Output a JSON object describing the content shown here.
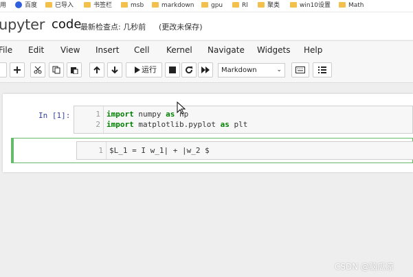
{
  "bookmarks": [
    {
      "label": "用",
      "icon": "none"
    },
    {
      "label": "百度",
      "icon": "baidu-icon"
    },
    {
      "label": "已导入",
      "icon": "folder-icon"
    },
    {
      "label": "书签栏",
      "icon": "folder-icon"
    },
    {
      "label": "msb",
      "icon": "folder-icon"
    },
    {
      "label": "markdown",
      "icon": "folder-icon"
    },
    {
      "label": "gpu",
      "icon": "folder-icon"
    },
    {
      "label": "Rl",
      "icon": "folder-icon"
    },
    {
      "label": "聚类",
      "icon": "folder-icon"
    },
    {
      "label": "win10设置",
      "icon": "folder-icon"
    },
    {
      "label": "Math",
      "icon": "folder-icon"
    }
  ],
  "header": {
    "logo_text": "upyter",
    "notebook_name": "code",
    "checkpoint": "最新检查点: 几秒前",
    "autosave": "(更改未保存)"
  },
  "menu": [
    "File",
    "Edit",
    "View",
    "Insert",
    "Cell",
    "Kernel",
    "Navigate",
    "Widgets",
    "Help"
  ],
  "toolbar": {
    "run_label": "运行",
    "cell_type": "Markdown"
  },
  "cell1": {
    "prompt": "In  [1]:",
    "lines": [
      {
        "num": "1",
        "kw1": "import",
        "mid": " numpy ",
        "kw2": "as",
        "end": " np"
      },
      {
        "num": "2",
        "kw1": "import",
        "mid": " matplotlib.pyplot ",
        "kw2": "as",
        "end": " plt"
      }
    ]
  },
  "cell2": {
    "line_num": "1",
    "text": "$L_1 = I w_1| + |w_2 $"
  },
  "watermark": "CSDN @脑瓜凉",
  "colors": {
    "accent_green": "#66bb6a",
    "prompt_blue": "#303f9f",
    "keyword": "#008000"
  }
}
